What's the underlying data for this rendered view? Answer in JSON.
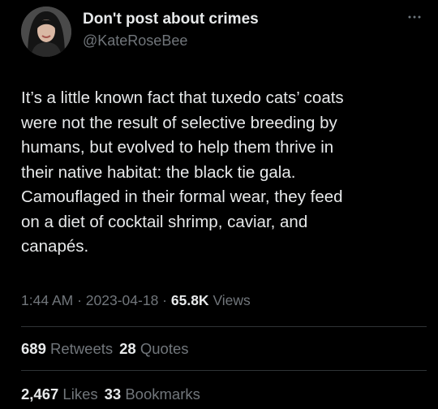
{
  "author": {
    "display_name": "Don't post about crimes",
    "handle": "@KateRoseBee"
  },
  "more_icon": "more-dots-icon",
  "tweet": {
    "lines": [
      "It’s a little known fact that tuxedo cats’ coats",
      "were not the result of selective breeding by",
      "humans, but evolved to help them thrive in",
      "their native habitat: the black tie gala.",
      "Camouflaged in their formal wear, they feed",
      "on a diet of cocktail shrimp, caviar, and",
      "canapés."
    ]
  },
  "meta": {
    "time": "1:44 AM",
    "sep1": " · ",
    "date": "2023-04-18",
    "sep2": " · ",
    "views_count": "65.8K",
    "views_label": " Views"
  },
  "stats": {
    "retweets_count": "689",
    "retweets_label": " Retweets",
    "quotes_count": "28",
    "quotes_label": " Quotes",
    "likes_count": "2,467",
    "likes_label": " Likes",
    "bookmarks_count": "33",
    "bookmarks_label": " Bookmarks"
  }
}
